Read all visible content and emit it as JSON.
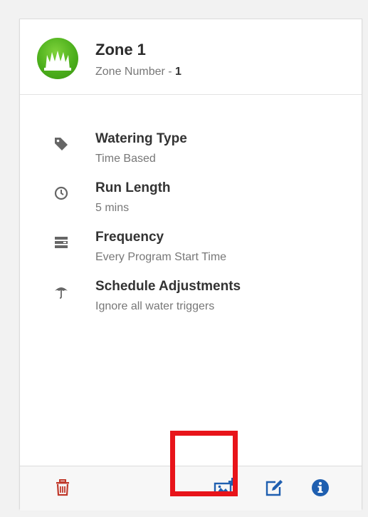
{
  "zone": {
    "title": "Zone 1",
    "number_label": "Zone Number - ",
    "number_value": "1"
  },
  "details": [
    {
      "label": "Watering Type",
      "value": "Time Based",
      "icon": "tag-icon"
    },
    {
      "label": "Run Length",
      "value": "5 mins",
      "icon": "clock-icon"
    },
    {
      "label": "Frequency",
      "value": "Every Program Start Time",
      "icon": "calendar-list-icon"
    },
    {
      "label": "Schedule Adjustments",
      "value": "Ignore all water triggers",
      "icon": "umbrella-icon"
    }
  ],
  "footer": {
    "buttons": [
      "trash-icon",
      "add-image-icon",
      "edit-icon",
      "info-icon"
    ]
  },
  "colors": {
    "accent_green": "#4caf1c",
    "delete_red": "#c0392b",
    "action_blue": "#1f5fb0",
    "highlight_red": "#e8141a"
  }
}
